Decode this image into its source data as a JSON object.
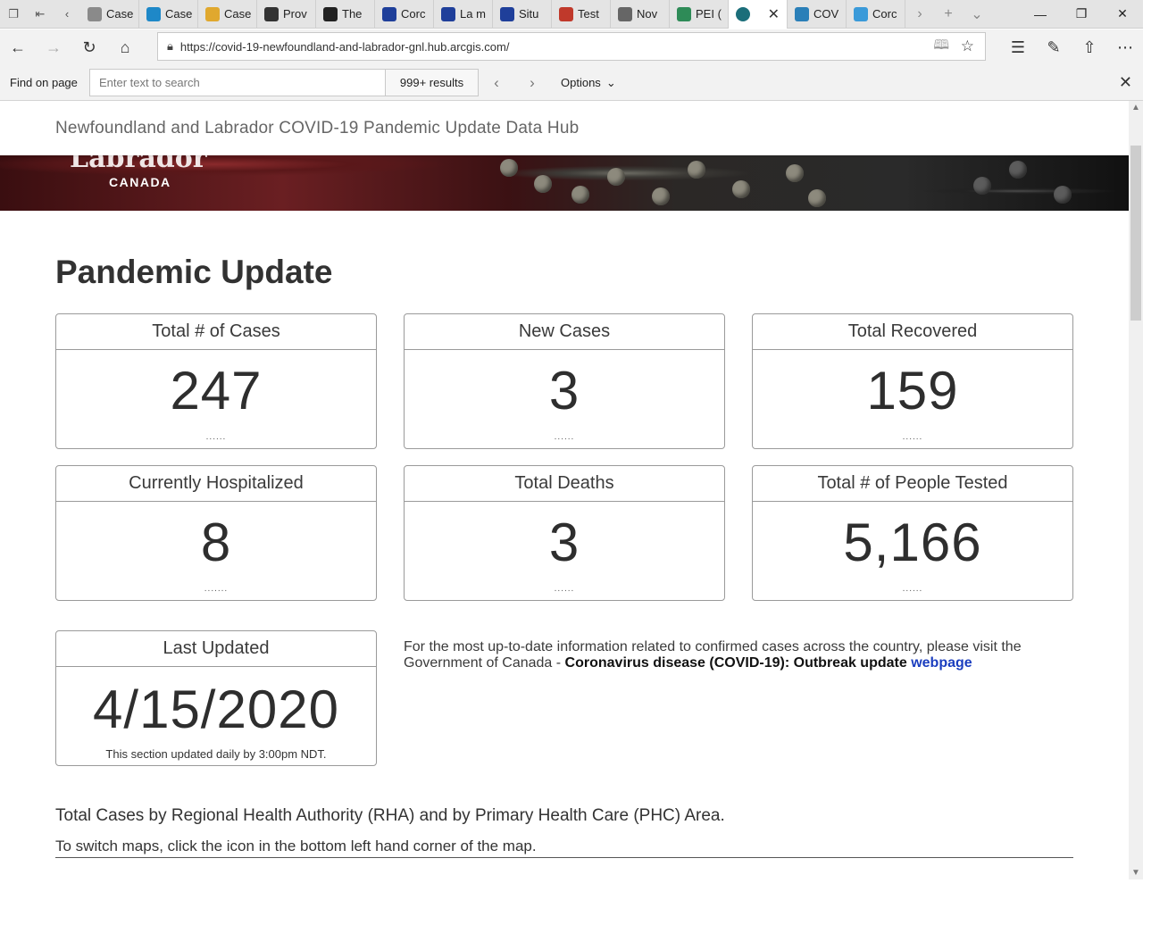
{
  "browser": {
    "tabs": [
      {
        "label": "Case",
        "icon": "document-icon",
        "color": "#8a8a8a"
      },
      {
        "label": "Case",
        "icon": "chart-icon",
        "color": "#1e88c8"
      },
      {
        "label": "Case",
        "icon": "flag-icon",
        "color": "#e0a82e"
      },
      {
        "label": "Prov",
        "icon": "horse-icon",
        "color": "#333333"
      },
      {
        "label": "The",
        "icon": "shield-icon",
        "color": "#222222"
      },
      {
        "label": "Corc",
        "icon": "fleur-de-lis-icon",
        "color": "#1f3f9a"
      },
      {
        "label": "La m",
        "icon": "fleur-de-lis-icon",
        "color": "#1f3f9a"
      },
      {
        "label": "Situ",
        "icon": "fleur-de-lis-icon",
        "color": "#1f3f9a"
      },
      {
        "label": "Test",
        "icon": "pen-icon",
        "color": "#c0392b"
      },
      {
        "label": "Nov",
        "icon": "envelope-icon",
        "color": "#666666"
      },
      {
        "label": "PEI (",
        "icon": "island-icon",
        "color": "#2e8b57"
      }
    ],
    "active_tab": {
      "icon": "globe-icon",
      "color": "#1b6e7a"
    },
    "tabs_after": [
      {
        "label": "COV",
        "icon": "wave-icon",
        "color": "#2a7fb8"
      },
      {
        "label": "Corc",
        "icon": "wave-icon",
        "color": "#3a9ad9"
      }
    ],
    "url": "https://covid-19-newfoundland-and-labrador-gnl.hub.arcgis.com/",
    "find": {
      "label": "Find on page",
      "placeholder": "Enter text to search",
      "results": "999+ results",
      "options": "Options"
    }
  },
  "site": {
    "header_title": "Newfoundland and Labrador COVID-19 Pandemic Update Data Hub",
    "banner_logo": "Labrador",
    "banner_country": "CANADA",
    "heading": "Pandemic Update"
  },
  "stats": [
    {
      "title": "Total # of Cases",
      "value": "247",
      "dots": "......"
    },
    {
      "title": "New Cases",
      "value": "3",
      "dots": "......"
    },
    {
      "title": "Total Recovered",
      "value": "159",
      "dots": "......"
    },
    {
      "title": "Currently Hospitalized",
      "value": "8",
      "dots": "......."
    },
    {
      "title": "Total Deaths",
      "value": "3",
      "dots": "......"
    },
    {
      "title": "Total # of People Tested",
      "value": "5,166",
      "dots": "......"
    }
  ],
  "last_updated": {
    "title": "Last Updated",
    "value": "4/15/2020",
    "note": "This section updated daily by 3:00pm NDT."
  },
  "info": {
    "text": "For the most up-to-date information related to confirmed cases across the country, please visit the Government of Canada -",
    "bold": "Coronavirus disease (COVID-19): Outbreak update",
    "link": "webpage"
  },
  "maps": {
    "heading": "Total Cases by Regional Health Authority (RHA) and by Primary Health Care (PHC) Area.",
    "instruction": "To switch maps, click the icon in the bottom left hand corner of the map."
  }
}
